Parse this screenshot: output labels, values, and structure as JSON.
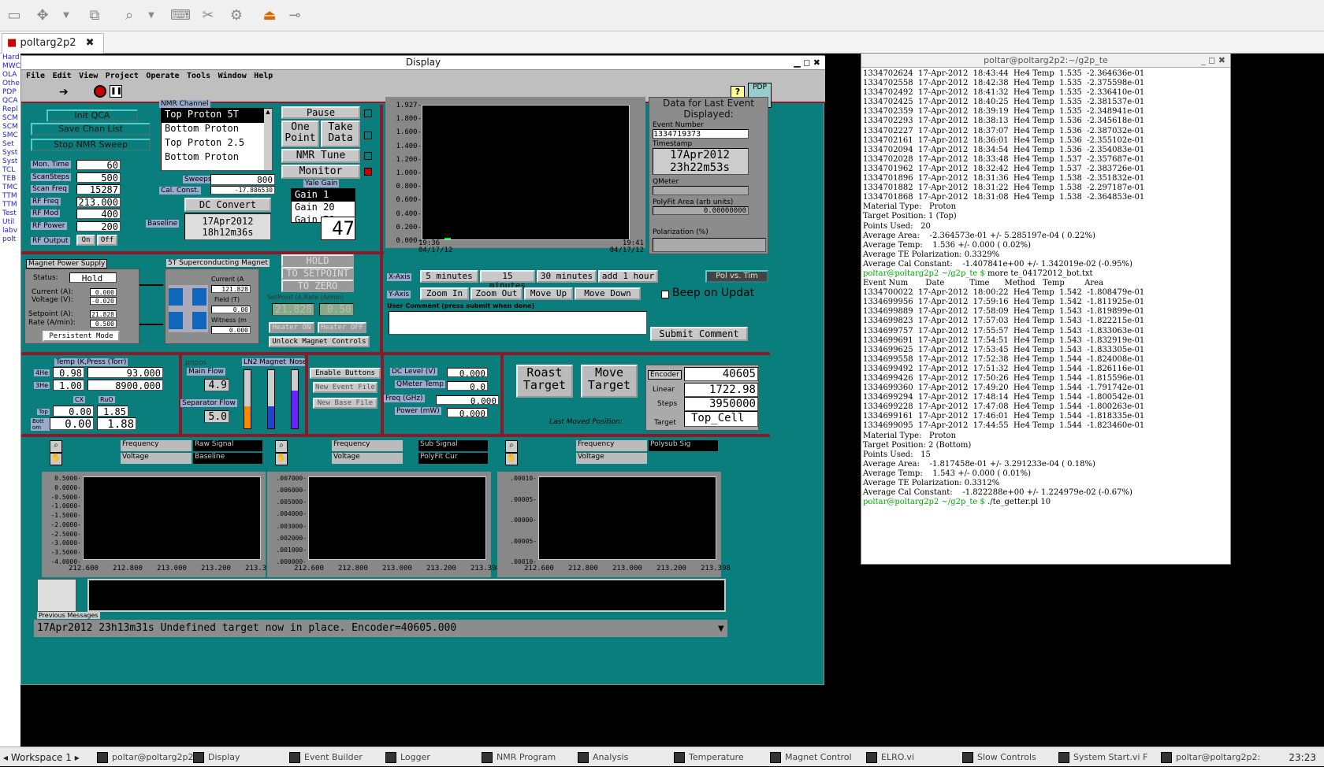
{
  "tab": {
    "title": "poltarg2p2"
  },
  "left_strip": [
    "Hard",
    "MWC",
    "OLA",
    "Othe",
    "PDP",
    "QCA",
    "Repl",
    "SCM",
    "SCM",
    "SMC",
    "Set ",
    "Syst",
    "Syst",
    "TCL",
    "TEB",
    "TMC",
    "TTM",
    "TTM",
    "Test",
    "Util",
    "labv",
    "polt"
  ],
  "display": {
    "title": "Display",
    "menu": [
      "File",
      "Edit",
      "View",
      "Project",
      "Operate",
      "Tools",
      "Window",
      "Help"
    ],
    "buttons": {
      "init_qca": "Init QCA",
      "save_chan": "Save Chan List",
      "stop_nmr": "Stop NMR Sweep",
      "pause": "Pause",
      "one_point": "One Point",
      "take_data": "Take Data",
      "nmr_tune": "NMR Tune",
      "monitor": "Monitor",
      "dc_convert": "DC Convert",
      "hold": "HOLD",
      "to_setpoint": "TO SETPOINT",
      "to_zero": "TO ZERO",
      "heater_on": "Heater ON",
      "heater_off": "Heater OFF",
      "unlock": "Unlock Magnet Controls",
      "enable": "Enable Buttons",
      "new_event": "New Event File",
      "new_base": "New Base File",
      "roast": "Roast Target",
      "move": "Move Target",
      "submit": "Submit Comment",
      "persistent": "Persistent Mode",
      "on": "On",
      "off": "Off",
      "pdp": "PDP"
    },
    "params": [
      {
        "label": "Mon. Time",
        "value": "60"
      },
      {
        "label": "ScanSteps",
        "value": "500"
      },
      {
        "label": "Scan Freq",
        "value": "15287"
      },
      {
        "label": "RF Freq",
        "value": "213.000"
      },
      {
        "label": "RF Mod",
        "value": "400"
      },
      {
        "label": "RF Power",
        "value": "200"
      }
    ],
    "rf_output_label": "RF Output",
    "nmr_channel": {
      "label": "NMR Channel",
      "items": [
        "Top Proton 5T",
        "Bottom Proton",
        "Top Proton 2.5",
        "Bottom Proton"
      ]
    },
    "sweeps": {
      "label": "Sweeps",
      "value": "800"
    },
    "cal_const": {
      "label": "Cal. Const.",
      "value": "-17.886530"
    },
    "yale_gain": {
      "label": "Yale Gain",
      "items": [
        "Gain 1",
        "Gain 20",
        "Gain 50"
      ]
    },
    "big_count": "47",
    "baseline": {
      "label": "Baseline",
      "value": "17Apr2012 18h12m36s"
    },
    "strip_chart": {
      "y_ticks": [
        "1.927-",
        "1.800-",
        "1.600-",
        "1.400-",
        "1.200-",
        "1.000-",
        "0.800-",
        "0.600-",
        "0.400-",
        "0.200-",
        "0.000-"
      ],
      "x_left": "19:36 04/17/12",
      "x_right": "19:41 04/17/12"
    },
    "last_event": {
      "title": "Data for Last Event Displayed:",
      "event_label": "Event Number",
      "event": "1334719373",
      "ts_label": "Timestamp",
      "ts": "17Apr2012 23h22m53s",
      "qmeter_label": "QMeter",
      "polyfit_label": "PolyFit Area (arb units)",
      "polyfit": "0.00000000",
      "pol_label": "Polarization (%)"
    },
    "xaxis": {
      "label": "X-Axis",
      "buttons": [
        "5 minutes",
        "15 minutes",
        "30 minutes",
        "add 1 hour"
      ]
    },
    "yaxis": {
      "label": "Y-Axis",
      "buttons": [
        "Zoom In",
        "Zoom Out",
        "Move Up",
        "Move Down"
      ]
    },
    "pol_vs_time": "Pol vs. Tim",
    "beep": "Beep on Updat",
    "user_comment": "User Comment (press submit when done)",
    "magnet_ps": {
      "title": "Magnet Power Supply",
      "status_label": "Status:",
      "status": "Hold",
      "current_label": "Current (A):",
      "current": "0.000",
      "voltage_label": "Voltage (V):",
      "voltage": "-0.020",
      "setpoint_label": "Setpoint (A):",
      "setpoint": "21.828",
      "rate_label": "Rate (A/min):",
      "rate": "0.500"
    },
    "st_magnet": {
      "title": "5T Superconducting Magnet",
      "current_label": "Current (A",
      "current": "121.828",
      "field_label": "Field (T)",
      "field": "0.00",
      "witness_label": "Witness (m",
      "witness": "0.000",
      "setpoint_label": "SetPoint (A,Rate (A/min)",
      "setpoint": "21.828",
      "rate": "0.50"
    },
    "temps": {
      "title": "Temp (K,Press (Torr)",
      "he4_label": "4He",
      "he4_t": "0.98",
      "he4_p": "93.000",
      "he3_label": "3He",
      "he3_t": "1.00",
      "he3_p": "8900.000",
      "cx_label": "CX",
      "ruo_label": "RuO",
      "top_label": "Top",
      "top_cx": "0.00",
      "top_ruo": "1.85",
      "bot_label": "Bott om",
      "bot_cx": "0.00",
      "bot_ruo": "1.88"
    },
    "flow": {
      "title": "pnpos",
      "main_label": "Main Flow",
      "main": "4.9",
      "sep_label": "Separator Flow",
      "sep": "5.0",
      "ln2": "LN2",
      "magnet": "Magnet",
      "nose": "Nose"
    },
    "dc": {
      "level_label": "DC Level (V)",
      "level": "0.000",
      "qmeter_label": "QMeter Temp",
      "qmeter": "0.0",
      "freq_label": "Freq (GHz)",
      "freq": "0.000",
      "power_label": "Power (mW)",
      "power": "0.000"
    },
    "encoder": {
      "enc_label": "Encoder",
      "enc": "40605",
      "lin_label": "Linear",
      "lin": "1722.98",
      "steps_label": "Steps",
      "steps": "3950000",
      "target_label": "Target",
      "target": "Top_Cell",
      "last_moved": "Last Moved Position:"
    },
    "plots": [
      {
        "legend_a": "Frequency",
        "legend_b": "Voltage",
        "sig_a": "Raw Signal",
        "sig_b": "Baseline",
        "y": [
          "0.5000-",
          "0.0000-",
          "-0.5000-",
          "-1.0000-",
          "-1.5000-",
          "-2.0000-",
          "-2.5000-",
          "-3.0000-",
          "-3.5000-",
          "-4.0000-"
        ],
        "x": [
          "212.600",
          "212.800",
          "213.000",
          "213.200",
          "213.39"
        ]
      },
      {
        "legend_a": "Frequency",
        "legend_b": "Voltage",
        "sig_a": "Sub Signal",
        "sig_b": "PolyFit Cur",
        "y": [
          ".007000-",
          ".006000-",
          ".005000-",
          ".004000-",
          ".003000-",
          ".002000-",
          ".001000-",
          ".000000-"
        ],
        "x": [
          "212.600",
          "212.800",
          "213.000",
          "213.200",
          "213.398"
        ]
      },
      {
        "legend_a": "Frequency",
        "legend_b": "Voltage",
        "sig_a": "Polysub Sig",
        "sig_b": "",
        "y": [
          ".00010-",
          ".00005-",
          ".00000-",
          ".00005-",
          ".00010-"
        ],
        "x": [
          "212.600",
          "212.800",
          "213.000",
          "213.200",
          "213.398"
        ]
      }
    ],
    "prev_messages": "Previous Messages",
    "status_line": "17Apr2012 23h13m31s Undefined target now in place.  Encoder=40605.000"
  },
  "terminal": {
    "title": "poltar@poltarg2p2:~/g2p_te",
    "lines": [
      "1334702624  17-Apr-2012  18:43:44  He4 Temp  1.535  -2.364636e-01",
      "1334702558  17-Apr-2012  18:42:38  He4 Temp  1.535  -2.375598e-01",
      "1334702492  17-Apr-2012  18:41:32  He4 Temp  1.535  -2.336410e-01",
      "1334702425  17-Apr-2012  18:40:25  He4 Temp  1.535  -2.381537e-01",
      "1334702359  17-Apr-2012  18:39:19  He4 Temp  1.535  -2.348941e-01",
      "1334702293  17-Apr-2012  18:38:13  He4 Temp  1.536  -2.345618e-01",
      "1334702227  17-Apr-2012  18:37:07  He4 Temp  1.536  -2.387032e-01",
      "1334702161  17-Apr-2012  18:36:01  He4 Temp  1.536  -2.355102e-01",
      "1334702094  17-Apr-2012  18:34:54  He4 Temp  1.536  -2.354083e-01",
      "1334702028  17-Apr-2012  18:33:48  He4 Temp  1.537  -2.357687e-01",
      "1334701962  17-Apr-2012  18:32:42  He4 Temp  1.537  -2.383726e-01",
      "1334701896  17-Apr-2012  18:31:36  He4 Temp  1.538  -2.351832e-01",
      "1334701882  17-Apr-2012  18:31:22  He4 Temp  1.538  -2.297187e-01",
      "1334701868  17-Apr-2012  18:31:08  He4 Temp  1.538  -2.364853e-01",
      "",
      "Material Type:   Proton",
      "Target Position: 1 (Top)",
      "Points Used:   20",
      "Average Area:    -2.364573e-01 +/- 5.285197e-04 ( 0.22%)",
      "Average Temp:    1.536 +/- 0.000 ( 0.02%)",
      "Average TE Polarization: 0.3329%",
      "Average Cal Constant:    -1.407841e+00 +/- 1.342019e-02 (-0.95%)",
      "@@poltar@poltarg2p2 ~/g2p_te $ more te_04172012_bot.txt",
      "Event Num       Date          Time      Method   Temp        Area",
      "1334700022  17-Apr-2012  18:00:22  He4 Temp  1.542  -1.808479e-01",
      "1334699956  17-Apr-2012  17:59:16  He4 Temp  1.542  -1.811925e-01",
      "1334699889  17-Apr-2012  17:58:09  He4 Temp  1.543  -1.819899e-01",
      "1334699823  17-Apr-2012  17:57:03  He4 Temp  1.543  -1.822215e-01",
      "1334699757  17-Apr-2012  17:55:57  He4 Temp  1.543  -1.833063e-01",
      "1334699691  17-Apr-2012  17:54:51  He4 Temp  1.543  -1.832919e-01",
      "1334699625  17-Apr-2012  17:53:45  He4 Temp  1.543  -1.833305e-01",
      "1334699558  17-Apr-2012  17:52:38  He4 Temp  1.544  -1.824008e-01",
      "1334699492  17-Apr-2012  17:51:32  He4 Temp  1.544  -1.826116e-01",
      "1334699426  17-Apr-2012  17:50:26  He4 Temp  1.544  -1.815596e-01",
      "1334699360  17-Apr-2012  17:49:20  He4 Temp  1.544  -1.791742e-01",
      "1334699294  17-Apr-2012  17:48:14  He4 Temp  1.544  -1.800542e-01",
      "1334699228  17-Apr-2012  17:47:08  He4 Temp  1.544  -1.800263e-01",
      "1334699161  17-Apr-2012  17:46:01  He4 Temp  1.544  -1.818335e-01",
      "1334699095  17-Apr-2012  17:44:55  He4 Temp  1.544  -1.823460e-01",
      "",
      "Material Type:   Proton",
      "Target Position: 2 (Bottom)",
      "Points Used:   15",
      "Average Area:    -1.817458e-01 +/- 3.291233e-04 ( 0.18%)",
      "Average Temp:    1.543 +/- 0.000 ( 0.01%)",
      "Average TE Polarization: 0.3312%",
      "Average Cal Constant:    -1.822288e+00 +/- 1.224979e-02 (-0.67%)",
      "@@poltar@poltarg2p2 ~/g2p_te $ ./te_getter.pl 10"
    ]
  },
  "taskbar": {
    "workspace": "Workspace 1",
    "tasks": [
      "poltar@poltarg2p2:",
      "Display",
      "Event Builder",
      "Logger",
      "NMR Program",
      "Analysis",
      "Temperature",
      "Magnet Control",
      "ELRO.vi",
      "Slow Controls",
      "System Start.vi F",
      "poltar@poltarg2p2:"
    ],
    "clock": "23:23"
  }
}
